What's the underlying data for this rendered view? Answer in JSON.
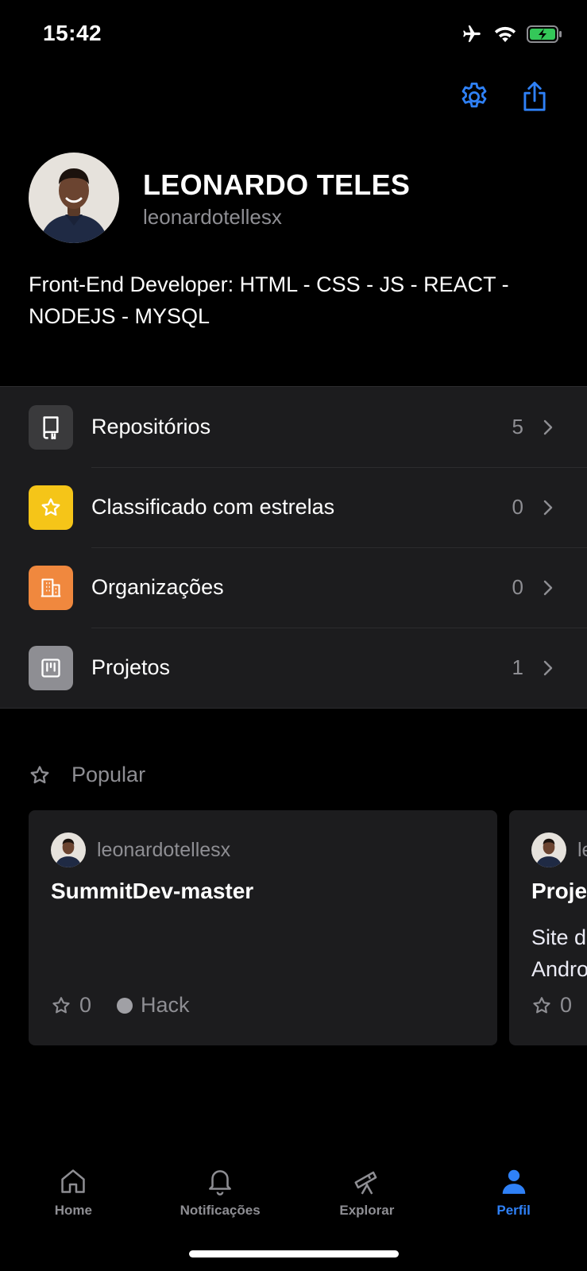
{
  "status_bar": {
    "time": "15:42"
  },
  "profile": {
    "name": "LEONARDO TELES",
    "login": "leonardotellesx",
    "bio": "Front-End Developer: HTML - CSS - JS - REACT - NODEJS - MYSQL"
  },
  "list": [
    {
      "label": "Repositórios",
      "count": "5",
      "icon": "repo-icon",
      "color": "#3a3a3c"
    },
    {
      "label": "Classificado com estrelas",
      "count": "0",
      "icon": "star-icon",
      "color": "#f5c518"
    },
    {
      "label": "Organizações",
      "count": "0",
      "icon": "organization-icon",
      "color": "#f0883e"
    },
    {
      "label": "Projetos",
      "count": "1",
      "icon": "project-icon",
      "color": "#8e8e93"
    }
  ],
  "popular": {
    "title": "Popular",
    "cards": [
      {
        "owner": "leonardotellesx",
        "title": "SummitDev-master",
        "description": "",
        "stars": "0",
        "language": "Hack"
      },
      {
        "owner": "leonardotellesx",
        "title": "Projeto",
        "description": "Site de\nAndroid",
        "stars": "0",
        "language": ""
      }
    ]
  },
  "tabbar": [
    {
      "label": "Home",
      "icon": "home-icon"
    },
    {
      "label": "Notificações",
      "icon": "bell-icon"
    },
    {
      "label": "Explorar",
      "icon": "telescope-icon"
    },
    {
      "label": "Perfil",
      "icon": "person-icon",
      "active": true
    }
  ],
  "colors": {
    "accent": "#2f81f7",
    "background": "#000000",
    "surface": "#1c1c1e",
    "muted": "#8e8e93"
  }
}
